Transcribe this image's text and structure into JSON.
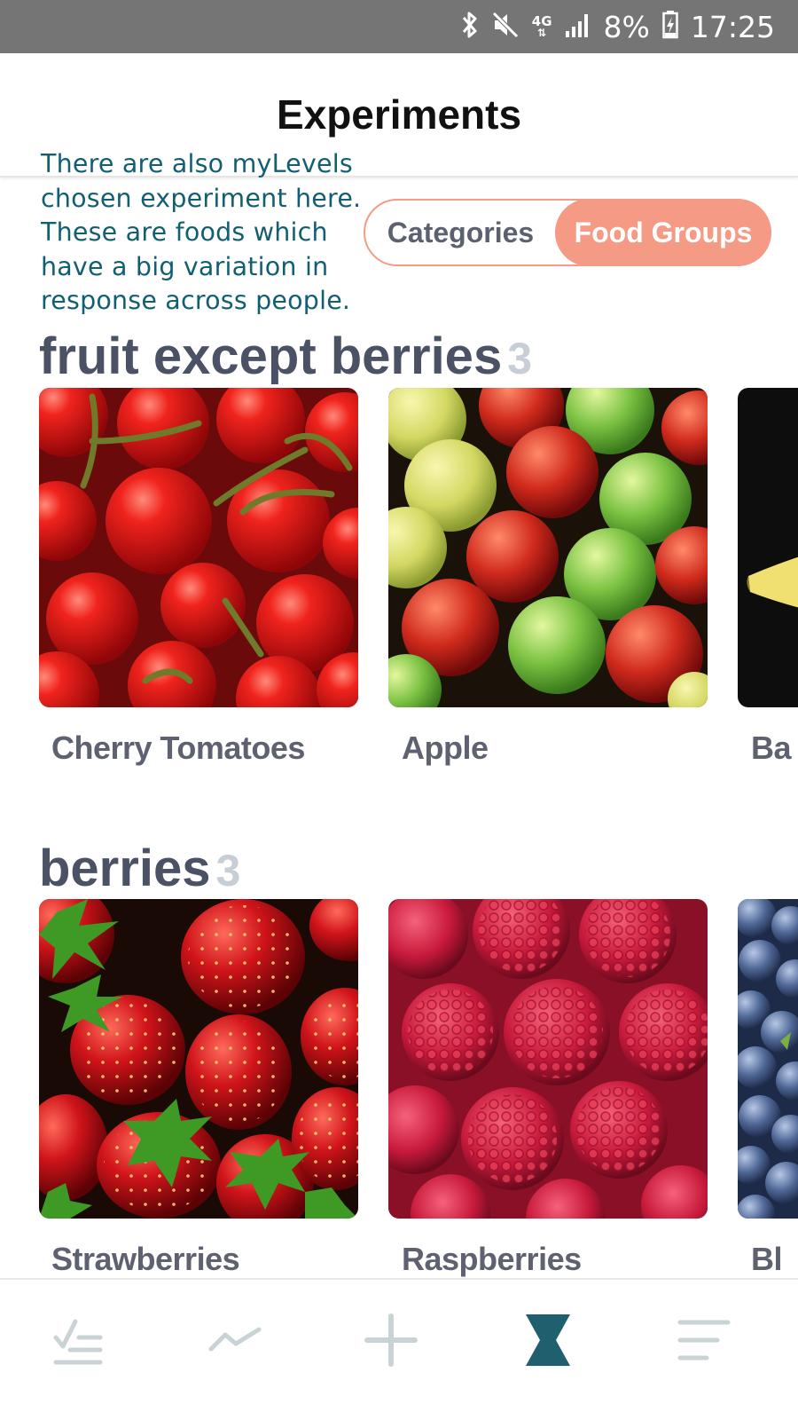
{
  "status_bar": {
    "battery": "8%",
    "time": "17:25",
    "network": "4G",
    "icons": [
      "bluetooth-icon",
      "mute-icon",
      "network-4g-icon",
      "signal-icon",
      "battery-charging-icon"
    ]
  },
  "header": {
    "title": "Experiments"
  },
  "annotation": {
    "lines": [
      "There are also myLevels",
      "chosen experiment here.",
      "These are foods which",
      "have a big variation in",
      "response across people."
    ]
  },
  "segmented": {
    "options": [
      "Categories",
      "Food Groups"
    ],
    "selected": "Food Groups"
  },
  "sections": [
    {
      "title": "fruit except berries",
      "count": "3",
      "items": [
        {
          "label": "Cherry Tomatoes",
          "image": "cherry-tomatoes-photo"
        },
        {
          "label": "Apple",
          "image": "apples-photo"
        },
        {
          "label": "Ba",
          "image": "banana-photo"
        }
      ]
    },
    {
      "title": "berries",
      "count": "3",
      "items": [
        {
          "label": "Strawberries",
          "image": "strawberries-photo"
        },
        {
          "label": "Raspberries",
          "image": "raspberries-photo"
        },
        {
          "label": "Bl",
          "image": "blueberries-photo"
        }
      ]
    }
  ],
  "bottom_nav": {
    "items": [
      {
        "icon": "checklist-icon",
        "active": false
      },
      {
        "icon": "trend-line-icon",
        "active": false
      },
      {
        "icon": "plus-icon",
        "active": false
      },
      {
        "icon": "hourglass-icon",
        "active": true
      },
      {
        "icon": "menu-lines-icon",
        "active": false
      }
    ]
  },
  "colors": {
    "accent": "#f59a85",
    "annotation": "#135f72",
    "section_title": "#4c5266",
    "count": "#c7ced6",
    "nav_active": "#1f5f6e",
    "nav_inactive": "#c9d3d6"
  }
}
